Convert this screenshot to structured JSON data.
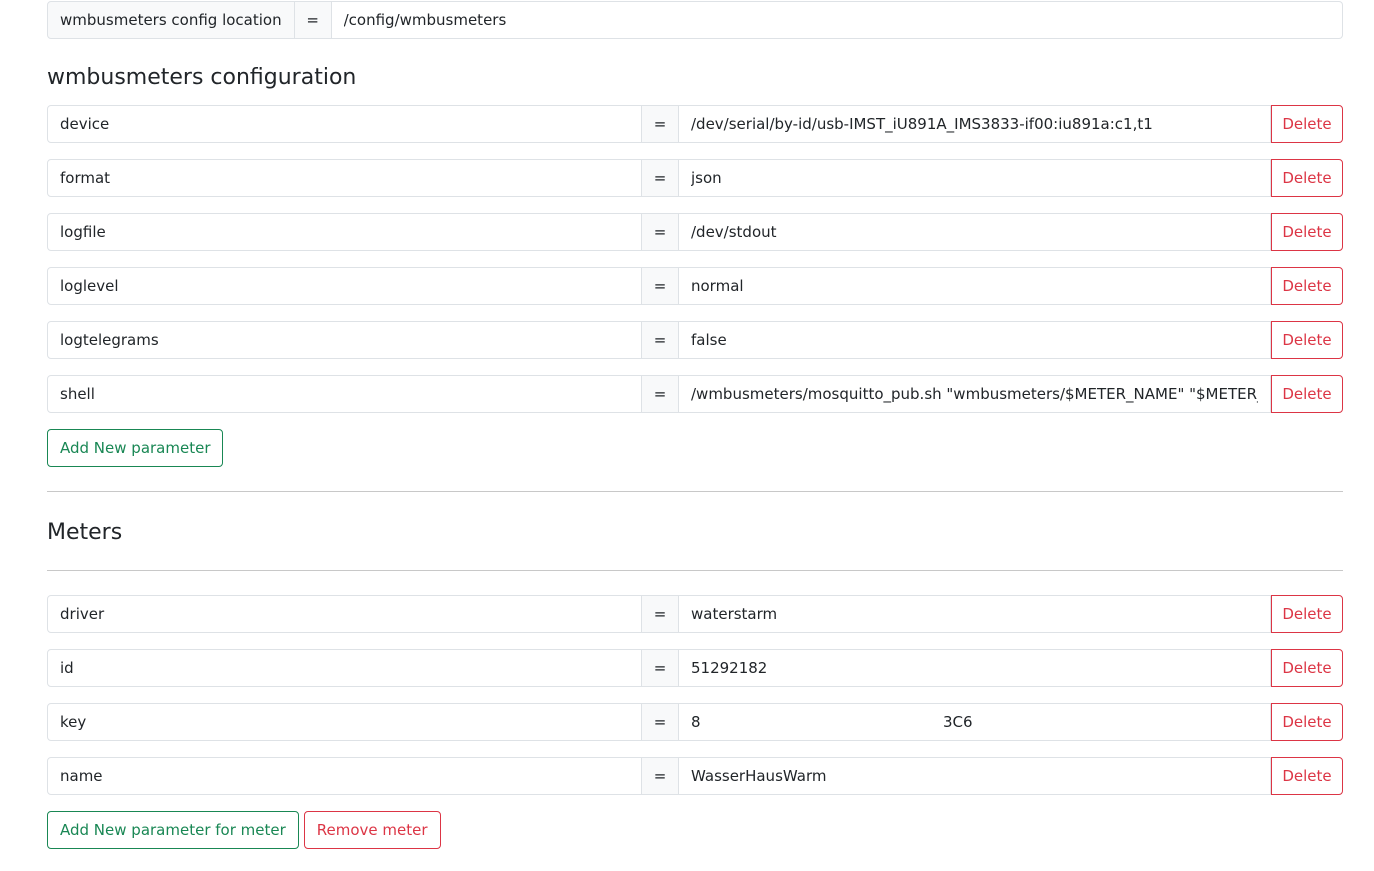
{
  "config_location": {
    "label": "wmbusmeters config location",
    "equals": "=",
    "value": "/config/wmbusmeters"
  },
  "configuration": {
    "title": "wmbusmeters configuration",
    "params": [
      {
        "key": "device",
        "value": "/dev/serial/by-id/usb-IMST_iU891A_IMS3833-if00:iu891a:c1,t1",
        "delete_label": "Delete"
      },
      {
        "key": "format",
        "value": "json",
        "delete_label": "Delete"
      },
      {
        "key": "logfile",
        "value": "/dev/stdout",
        "delete_label": "Delete"
      },
      {
        "key": "loglevel",
        "value": "normal",
        "delete_label": "Delete"
      },
      {
        "key": "logtelegrams",
        "value": "false",
        "delete_label": "Delete"
      },
      {
        "key": "shell",
        "value": "/wmbusmeters/mosquitto_pub.sh \"wmbusmeters/$METER_NAME\" \"$METER_JSON\"",
        "delete_label": "Delete"
      }
    ],
    "add_label": "Add New parameter"
  },
  "meters": {
    "title": "Meters",
    "params": [
      {
        "key": "driver",
        "value": "waterstarm",
        "delete_label": "Delete"
      },
      {
        "key": "id",
        "value": "51292182",
        "delete_label": "Delete"
      },
      {
        "key": "key",
        "value": "8",
        "value_tail": "3C6",
        "delete_label": "Delete"
      },
      {
        "key": "name",
        "value": "WasserHausWarm",
        "delete_label": "Delete"
      }
    ],
    "add_label": "Add New parameter for meter",
    "remove_label": "Remove meter"
  },
  "equals_sign": "=",
  "colors": {
    "danger": "#dc3545",
    "success": "#198754",
    "border": "#dee2e6",
    "addon_bg": "#f8f9fa"
  }
}
